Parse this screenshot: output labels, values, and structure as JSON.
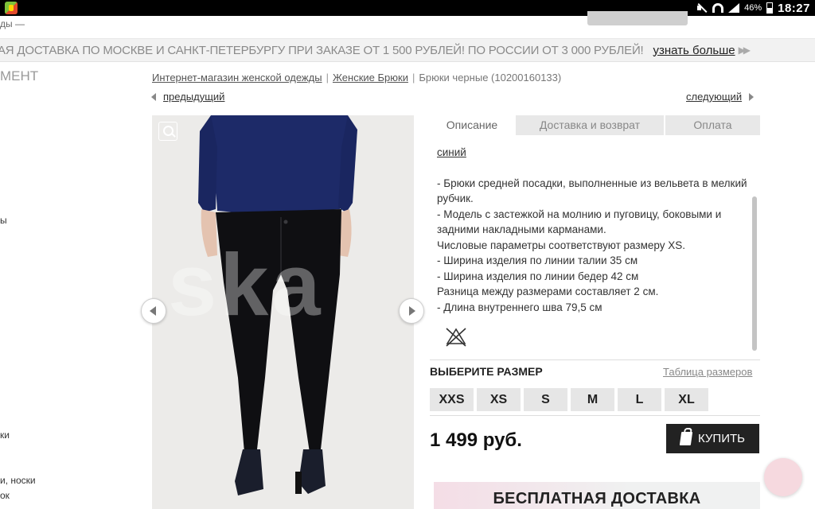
{
  "status_bar": {
    "battery": "46%",
    "clock": "18:27"
  },
  "header": {
    "top_fragment": "ды —"
  },
  "promo": {
    "text": "АЯ ДОСТАВКА ПО МОСКВЕ И САНКТ-ПЕТЕРБУРГУ ПРИ ЗАКАЗЕ ОТ 1 500 РУБЛЕЙ! ПО РОССИИ ОТ 3 000 РУБЛЕЙ!",
    "link": "узнать больше"
  },
  "sidebar": {
    "heading": "МЕНТ",
    "fragments": [
      "ы",
      "ки",
      "и, носки",
      "ок"
    ]
  },
  "breadcrumb": {
    "items": [
      "Интернет-магазин женской одежды",
      "Женские Брюки"
    ],
    "current": "Брюки черные (10200160133)"
  },
  "nav": {
    "prev": "предыдущий",
    "next": "следующий"
  },
  "image": {
    "watermark": "ska"
  },
  "tabs": [
    {
      "label": "Описание"
    },
    {
      "label": "Доставка и возврат"
    },
    {
      "label": "Оплата"
    }
  ],
  "description": {
    "color": "синий",
    "lines": [
      "- Брюки средней посадки, выполненные из вельвета в мелкий рубчик.",
      "- Модель с застежкой на молнию и пуговицу, боковыми и задними накладными карманами.",
      "Числовые параметры соответствуют размеру XS.",
      "- Ширина изделия по линии талии 35 см",
      "- Ширина изделия по линии бедер 42 см",
      "Разница между размерами составляет 2 см.",
      "- Длина внутреннего шва 79,5 см"
    ],
    "care_icon": "no-wash-icon"
  },
  "sizes": {
    "heading": "ВЫБЕРИТЕ РАЗМЕР",
    "chart_link": "Таблица размеров",
    "options": [
      "XXS",
      "XS",
      "S",
      "M",
      "L",
      "XL"
    ]
  },
  "price": "1 499 руб.",
  "buy_button": "КУПИТЬ",
  "free_shipping": "БЕСПЛАТНАЯ ДОСТАВКА"
}
